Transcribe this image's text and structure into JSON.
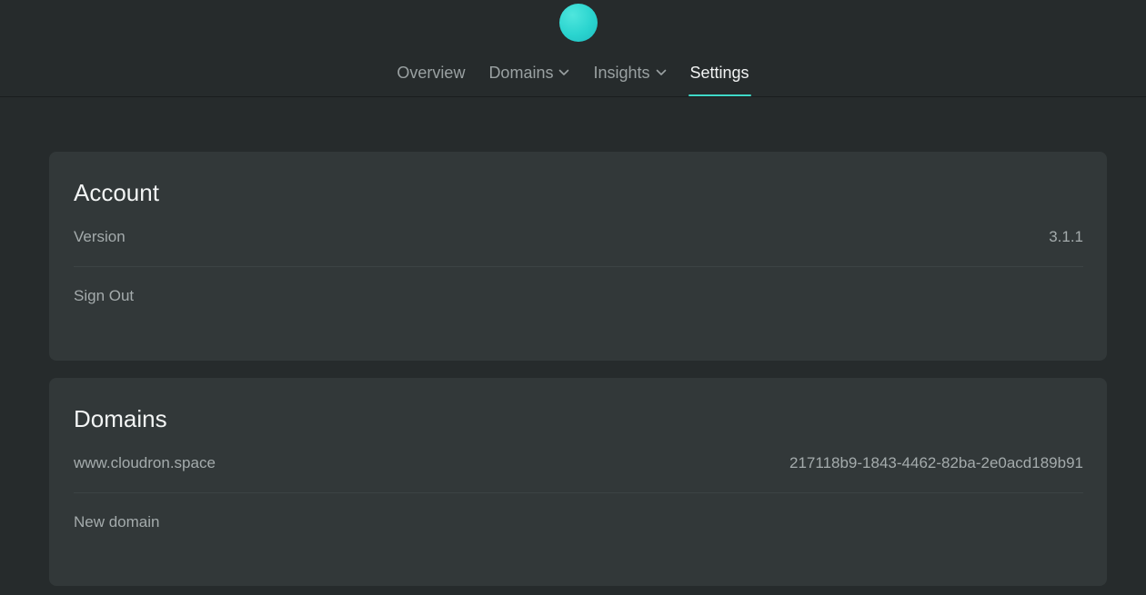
{
  "nav": {
    "items": [
      {
        "label": "Overview",
        "has_dropdown": false,
        "active": false
      },
      {
        "label": "Domains",
        "has_dropdown": true,
        "active": false
      },
      {
        "label": "Insights",
        "has_dropdown": true,
        "active": false
      },
      {
        "label": "Settings",
        "has_dropdown": false,
        "active": true
      }
    ]
  },
  "account": {
    "title": "Account",
    "version_label": "Version",
    "version_value": "3.1.1",
    "sign_out_label": "Sign Out"
  },
  "domains": {
    "title": "Domains",
    "items": [
      {
        "name": "www.cloudron.space",
        "id": "217118b9-1843-4462-82ba-2e0acd189b91"
      }
    ],
    "new_domain_label": "New domain"
  },
  "colors": {
    "background": "#262b2c",
    "card": "#323839",
    "accent": "#3fd9c8",
    "logo": "#2ad4cf"
  }
}
